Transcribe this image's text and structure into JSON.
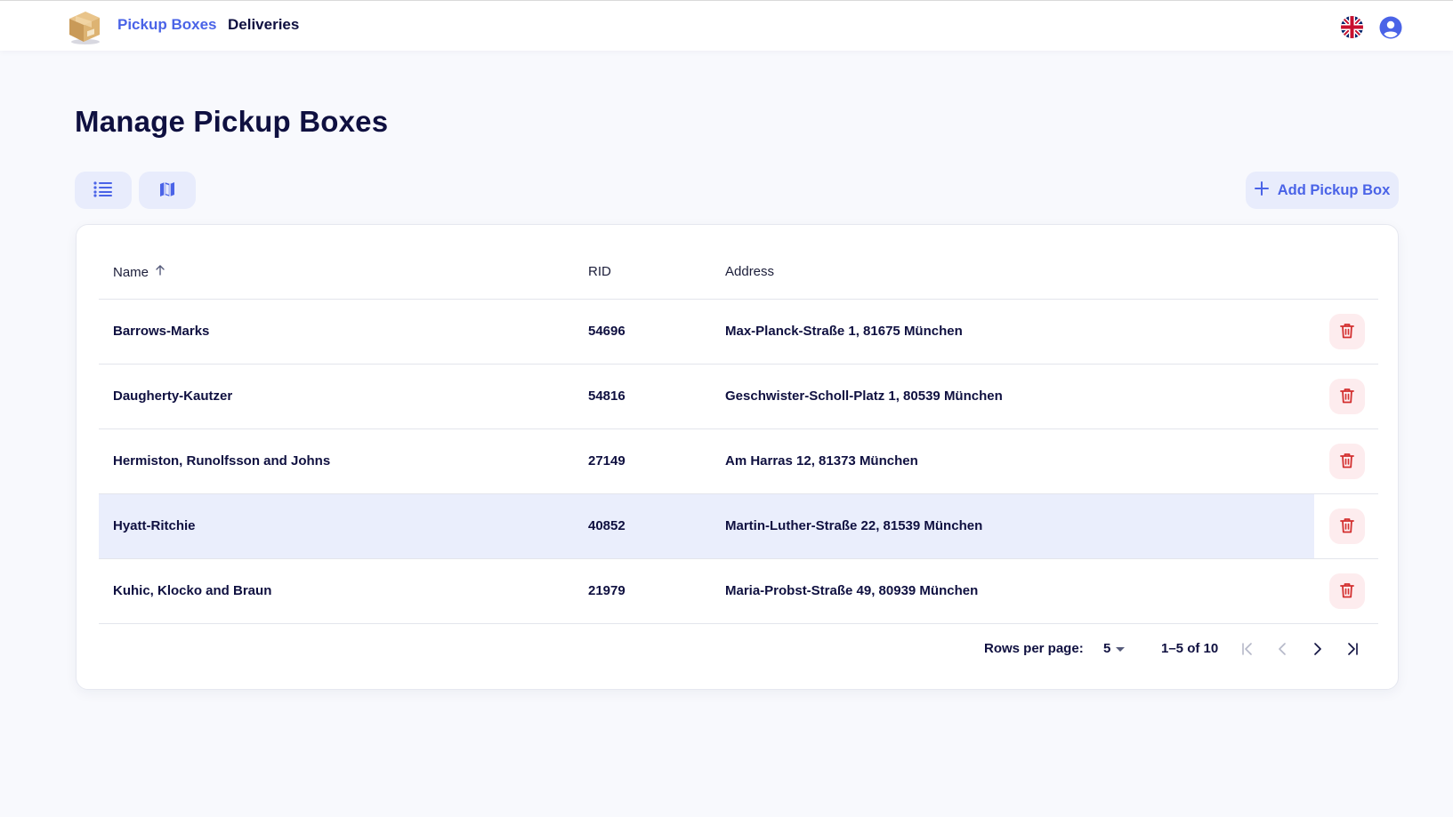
{
  "nav": {
    "logo_icon": "package-box-icon",
    "links": [
      {
        "label": "Pickup Boxes",
        "active": true
      },
      {
        "label": "Deliveries",
        "active": false
      }
    ],
    "language_icon": "uk-flag-icon",
    "user_icon": "account-circle-icon"
  },
  "page": {
    "title": "Manage Pickup Boxes"
  },
  "toolbar": {
    "list_view_icon": "list-icon",
    "map_view_icon": "map-icon",
    "add_label": "Add Pickup Box",
    "add_icon": "plus-icon"
  },
  "table": {
    "columns": [
      "Name",
      "RID",
      "Address"
    ],
    "sort": {
      "column": "Name",
      "direction": "asc"
    },
    "rows": [
      {
        "name": "Barrows-Marks",
        "rid": "54696",
        "address": "Max-Planck-Straße 1, 81675 München"
      },
      {
        "name": "Daugherty-Kautzer",
        "rid": "54816",
        "address": "Geschwister-Scholl-Platz 1, 80539 München"
      },
      {
        "name": "Hermiston, Runolfsson and Johns",
        "rid": "27149",
        "address": "Am Harras 12, 81373 München"
      },
      {
        "name": "Hyatt-Ritchie",
        "rid": "40852",
        "address": "Martin-Luther-Straße 22, 81539 München"
      },
      {
        "name": "Kuhic, Klocko and Braun",
        "rid": "21979",
        "address": "Maria-Probst-Straße 49, 80939 München"
      }
    ],
    "highlighted_row": 3,
    "row_action_icon": "trash-icon"
  },
  "pagination": {
    "rows_per_page_label": "Rows per page:",
    "rows_per_page": "5",
    "range": "1–5 of 10"
  },
  "colors": {
    "accent": "#4a63e7",
    "text": "#0f1040",
    "danger": "#d32f2f",
    "highlight": "#eaeefc"
  }
}
